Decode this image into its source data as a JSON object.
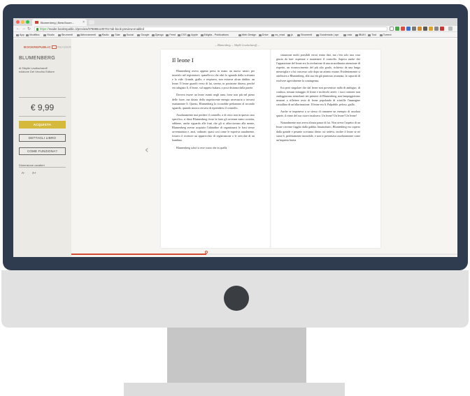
{
  "browser": {
    "tab_title": "Blumenberg | Beta Boom...",
    "url_scheme": "https://",
    "url_rest": "reader.bookrepublic.it/preview/9788861100701?ab-book-preview-enabled",
    "bookmarks": [
      "App",
      "Modifica",
      "Studio",
      "Strumenti",
      "Abbonamenti",
      "Radio",
      "Siae",
      "Social",
      "Google",
      "Django",
      "Feed",
      "CSS",
      "Apple",
      "Edigita - Publications",
      "Web Design",
      "Drive",
      "ns_read",
      "js",
      "Strumenti",
      "Goodreads | apr",
      "rata",
      "IBUKI",
      "Tool",
      "Torrent"
    ]
  },
  "sidebar": {
    "logo_brand": "BOOKREPUBLIC",
    "logo_reader": "READER",
    "book_title": "BLUMENBERG",
    "author_line1": "di Sibylle Lewitscharoff",
    "author_line2": "edizione Del Vecchio Editore",
    "price": "€ 9,99",
    "buy_label": "ACQUISTA",
    "details_label": "DETTAGLI LIBRO",
    "how_label": "COME FUNZIONA?",
    "font_size_label": "Dimensione caratteri",
    "font_smaller": "A-",
    "font_larger": "A+"
  },
  "reader": {
    "breadcrumb": "— Blumenberg — Sibylle Lewitscharoff —",
    "chapter_title": "Il leone I",
    "left_paragraphs": [
      "Blumenberg aveva appena preso in mano un nuovo nastro per inserirlo nel registratore, quand'ecco che alzò lo sguardo dalla scrivania e lo vide. Grande, giallo, e respirava, non esisteva alcun dubbio: un leone. Il leone guardò verso di lui, sereno, in posizione distesa, perché era adagiato lì, il leone, sul tappeto bukara, a poca distanza dalla parete.",
      "Doveva essere un leone avanti negli anni, forse non più nel pieno delle forze, ma dotato della stupefacente energia necessaria a trovarsi esattamente lì. Questo, Blumenberg lo riconobbe perlomeno al secondo sguardo, quando ancora cercava di riprendersi il controllo.",
      "Assolutamente mai perdere il controllo, a di certo non in questo caso specifico, si disse Blumenberg; forse la frase gli avvenne meno corretta, sebbene, anche riguardo alle frasi che gli si affacciavano alla mente, Blumenberg avesse acquisito l'abitudine di organizzarsi le frasi stesse avventatezza e, anzi, ordinate, quasi così come le esperiva usualmente, fossero il ricettore un apparecchio di registrazione o le orecchie di un bambino.",
      "Blumenberg schiò si rese conto che in quella"
    ],
    "right_paragraphs": [
      "situazione molti possibili errori erano dati, ma c'era solo una cosa giusta da fare: aspettare e mantenere il controllo. Sapeva anche che l'apparizione del leone era la rivelazione di una straordinaria attenzione di rispetto, un riconoscimento del più alto grado, richiesto da una lunga meraviglia e a lui concesso solo dopo un attento esame. Evidentemente si attribuiva a Blumenberg, alla sua età già piuttosto avanzata, la capacità di risolvere agevolmente la contingenza.",
      "Era però singolare che dal leone non provenisse nulla di ambiguo, di confuso, nessun miraggio di leone e molecole aeree; i suoi contorni non ondeggiavano tremolanti nei pensieri di Blumenberg, non lampeggiavano neuroni a riflettere testo di leone popolando di scintille l'immagine cristallina di un'allucinazione. Il leone era lì. Palpabile, peloso, giallo.",
      "Anche se imponeva a se stesso di rimanere un esempio di assoluta quiete, il ritmo del suo cuore incalzava. Un leone! Un leone! Un leone!",
      "Naturalmente non aveva alcuna paura di lui. Non aveva l'aspetto di un leone circense fuggito dalla gabbia. Innanzitutto, Blumenberg era coperto dalla grande e pesante scrivania dietro cui sedeva, inoltre il leone se ne stava lì, perfettamente immobile, e non si presentava assolutamente come un'inquieta bestia"
    ],
    "progress_fraction": 0.35
  }
}
